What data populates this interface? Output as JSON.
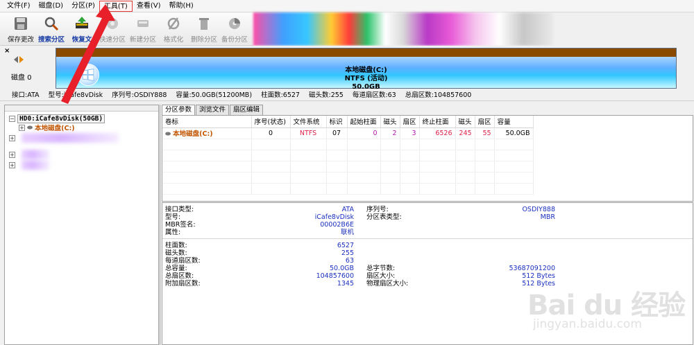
{
  "menu": [
    "文件(F)",
    "磁盘(D)",
    "分区(P)",
    "工具(T)",
    "查看(V)",
    "帮助(H)"
  ],
  "toolbar": [
    {
      "label": "保存更改",
      "icon": "save-icon"
    },
    {
      "label": "搜索分区",
      "icon": "search-icon"
    },
    {
      "label": "恢复文",
      "icon": "restore-icon"
    },
    {
      "label": "快速分区",
      "icon": "quick-partition-icon"
    },
    {
      "label": "新建分区",
      "icon": "new-partition-icon"
    },
    {
      "label": "格式化",
      "icon": "format-icon"
    },
    {
      "label": "删除分区",
      "icon": "delete-icon"
    },
    {
      "label": "备份分区",
      "icon": "backup-icon"
    }
  ],
  "disk_panel": {
    "disk_label": "磁盘 0",
    "bar_name": "本地磁盘(C:)",
    "bar_fs": "NTFS (活动)",
    "bar_size": "50.0GB"
  },
  "info_strip": [
    "接口:ATA",
    "型号:iCafe8vDisk",
    "序列号:OSDIY888",
    "容量:50.0GB(51200MB)",
    "柱面数:6527",
    "磁头数:255",
    "每道扇区数:63",
    "总扇区数:104857600"
  ],
  "tree": {
    "disk": "HD0:iCafe8vDisk(50GB)",
    "partition": "本地磁盘(C:)"
  },
  "tabs": [
    "分区参数",
    "浏览文件",
    "扇区编辑"
  ],
  "table": {
    "headers": [
      "卷标",
      "序号(状态)",
      "文件系统",
      "标识",
      "起始柱面",
      "磁头",
      "扇区",
      "终止柱面",
      "磁头",
      "扇区",
      "容量"
    ],
    "rows": [
      [
        "本地磁盘(C:)",
        "0",
        "NTFS",
        "07",
        "0",
        "2",
        "3",
        "6526",
        "245",
        "55",
        "50.0GB"
      ]
    ]
  },
  "props": {
    "group1": [
      {
        "label": "接口类型:",
        "value": "ATA",
        "label2": "序列号:",
        "value2": "OSDIY888"
      },
      {
        "label": "型号:",
        "value": "iCafe8vDisk",
        "label2": "分区表类型:",
        "value2": "MBR"
      },
      {
        "label": "MBR签名:",
        "value": "00002B6E",
        "label2": "",
        "value2": ""
      },
      {
        "label": "属性:",
        "value": "联机",
        "label2": "",
        "value2": ""
      }
    ],
    "group2": [
      {
        "label": "柱面数:",
        "value": "6527",
        "label2": "",
        "value2": ""
      },
      {
        "label": "磁头数:",
        "value": "255",
        "label2": "",
        "value2": ""
      },
      {
        "label": "每道扇区数:",
        "value": "63",
        "label2": "",
        "value2": ""
      },
      {
        "label": "总容量:",
        "value": "50.0GB",
        "label2": "总字节数:",
        "value2": "53687091200"
      },
      {
        "label": "总扇区数:",
        "value": "104857600",
        "label2": "扇区大小:",
        "value2": "512 Bytes"
      },
      {
        "label": "附加扇区数:",
        "value": "1345",
        "label2": "物理扇区大小:",
        "value2": "512 Bytes"
      }
    ]
  },
  "watermark": {
    "logo": "Bai du 经验",
    "sub": "jingyan.baidu.com"
  }
}
